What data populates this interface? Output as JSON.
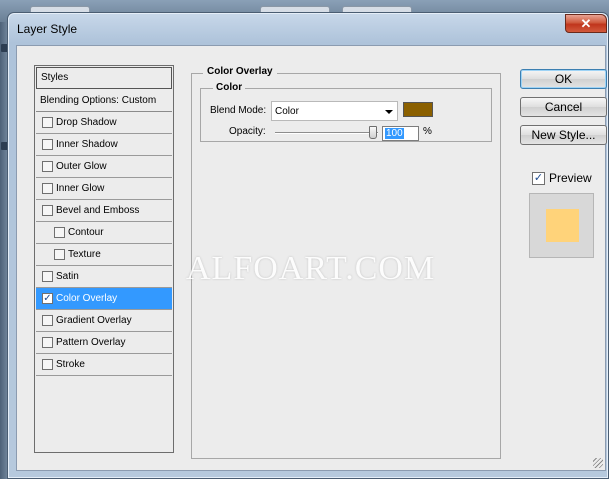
{
  "window": {
    "title": "Layer Style",
    "close_symbol": "✕"
  },
  "watermark": "ALFOART.COM",
  "left_panel": {
    "header": "Styles",
    "blending": "Blending Options: Custom",
    "items": [
      {
        "label": "Drop Shadow",
        "checked": false,
        "indent": false,
        "selected": false
      },
      {
        "label": "Inner Shadow",
        "checked": false,
        "indent": false,
        "selected": false
      },
      {
        "label": "Outer Glow",
        "checked": false,
        "indent": false,
        "selected": false
      },
      {
        "label": "Inner Glow",
        "checked": false,
        "indent": false,
        "selected": false
      },
      {
        "label": "Bevel and Emboss",
        "checked": false,
        "indent": false,
        "selected": false
      },
      {
        "label": "Contour",
        "checked": false,
        "indent": true,
        "selected": false
      },
      {
        "label": "Texture",
        "checked": false,
        "indent": true,
        "selected": false
      },
      {
        "label": "Satin",
        "checked": false,
        "indent": false,
        "selected": false
      },
      {
        "label": "Color Overlay",
        "checked": true,
        "indent": false,
        "selected": true
      },
      {
        "label": "Gradient Overlay",
        "checked": false,
        "indent": false,
        "selected": false
      },
      {
        "label": "Pattern Overlay",
        "checked": false,
        "indent": false,
        "selected": false
      },
      {
        "label": "Stroke",
        "checked": false,
        "indent": false,
        "selected": false
      }
    ]
  },
  "content": {
    "section_title": "Color Overlay",
    "group_title": "Color",
    "blend_mode_label": "Blend Mode:",
    "blend_mode_value": "Color",
    "overlay_color": "#8b6000",
    "opacity_label": "Opacity:",
    "opacity_value": "100",
    "opacity_unit": "%",
    "opacity_fraction": 1.0
  },
  "buttons": {
    "ok": "OK",
    "cancel": "Cancel",
    "new_style": "New Style..."
  },
  "preview": {
    "label": "Preview",
    "checked": true,
    "swatch_color": "#ffd37a"
  },
  "icons": {
    "checkbox_checked": "checkbox-checked-icon",
    "select_arrow": "chevron-down-icon",
    "close": "close-icon"
  }
}
